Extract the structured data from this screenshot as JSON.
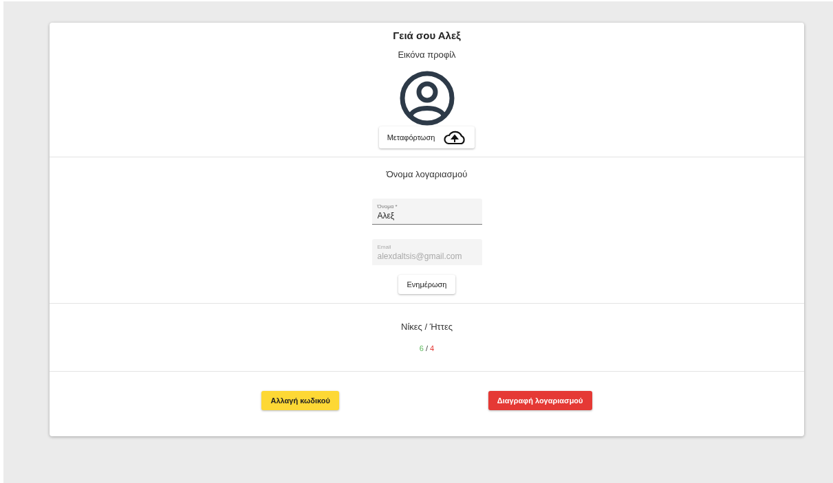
{
  "profile": {
    "greeting": "Γειά σου Αλεξ",
    "picture_label": "Εικόνα προφίλ",
    "upload_button": "Μεταφόρτωση"
  },
  "account": {
    "title": "Όνομα λογαριασμού",
    "fields": [
      {
        "label": "Όνομα *",
        "value": "Αλεξ",
        "disabled": false
      },
      {
        "label": "Email",
        "value": "alexdaltsis@gmail.com",
        "disabled": true
      }
    ],
    "update_button": "Ενημέρωση"
  },
  "stats": {
    "title": "Νίκες / Ήττες",
    "wins": "6",
    "separator": "/",
    "losses": "4"
  },
  "actions": [
    {
      "label": "Αλλαγή κωδικού",
      "kind": "warning"
    },
    {
      "label": "Διαγραφή λογαριασμού",
      "kind": "danger"
    }
  ]
}
